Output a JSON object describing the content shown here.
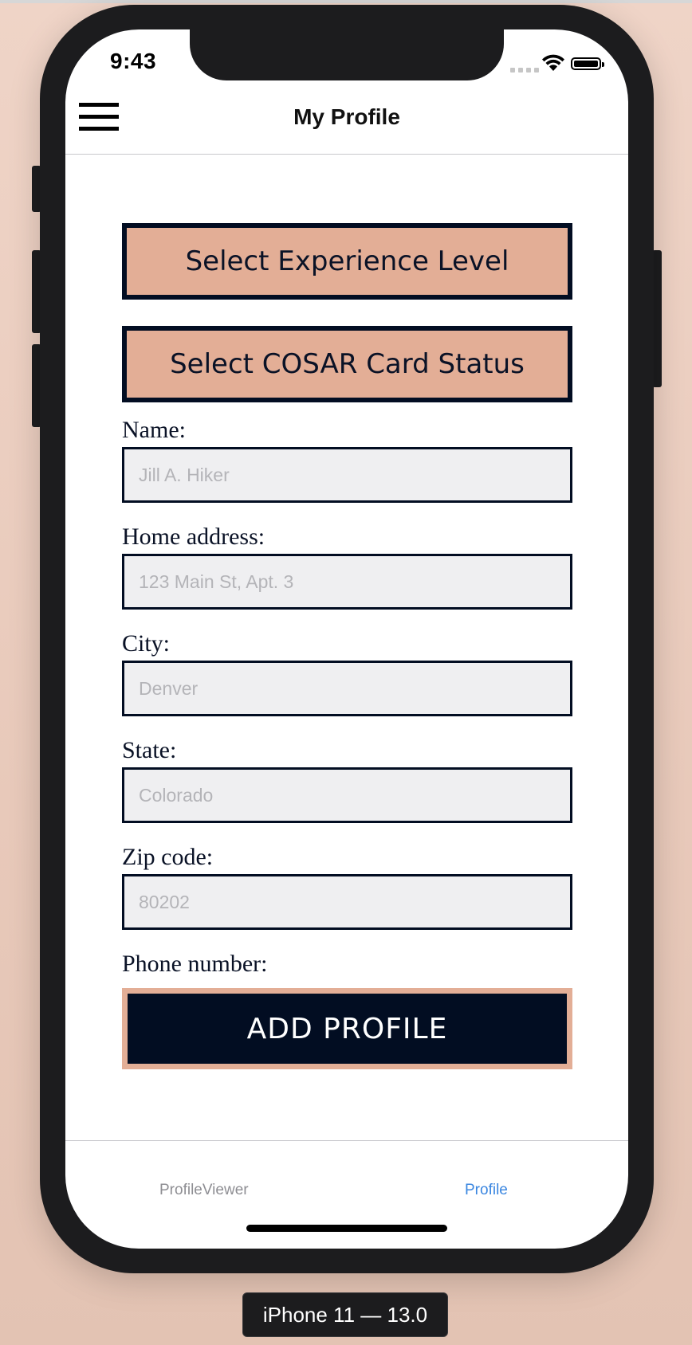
{
  "status_bar": {
    "time": "9:43",
    "icons": [
      "cellular-signal-icon",
      "wifi-icon",
      "battery-icon"
    ]
  },
  "nav": {
    "title": "My Profile",
    "menu_icon": "hamburger-menu-icon"
  },
  "buttons": {
    "experience_level": "Select Experience Level",
    "cosar_status": "Select COSAR Card Status",
    "add_profile": "ADD PROFILE"
  },
  "form": {
    "name": {
      "label": "Name:",
      "placeholder": "Jill A. Hiker",
      "value": ""
    },
    "address": {
      "label": "Home address:",
      "placeholder": "123 Main St, Apt. 3",
      "value": ""
    },
    "city": {
      "label": "City:",
      "placeholder": "Denver",
      "value": ""
    },
    "state": {
      "label": "State:",
      "placeholder": "Colorado",
      "value": ""
    },
    "zip": {
      "label": "Zip code:",
      "placeholder": "80202",
      "value": ""
    },
    "phone": {
      "label": "Phone number:"
    }
  },
  "tabs": [
    {
      "label": "ProfileViewer",
      "active": false
    },
    {
      "label": "Profile",
      "active": true
    }
  ],
  "device_label": "iPhone 11 — 13.0",
  "colors": {
    "accent_peach": "#e3ae96",
    "navy": "#020d22",
    "tab_active": "#3a86e0",
    "tab_inactive": "#8e8e93"
  }
}
